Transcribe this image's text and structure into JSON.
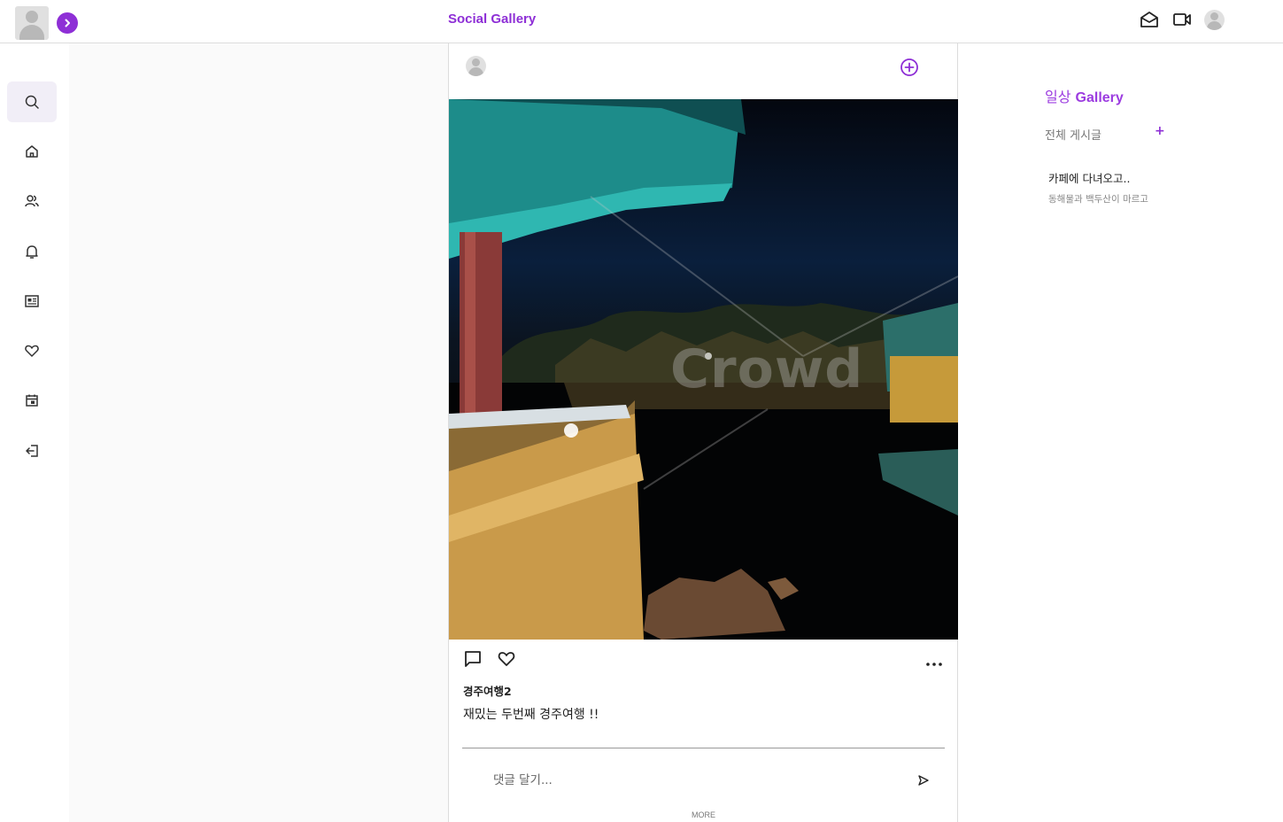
{
  "header": {
    "app_title": "Social Gallery",
    "brand_color": "#8e2fd6",
    "icons": [
      "profile-avatar-icon",
      "expand-sidebar-icon",
      "mail-icon",
      "video-icon",
      "user-avatar-icon"
    ]
  },
  "sidebar": {
    "items": [
      {
        "name": "search",
        "icon": "search-icon",
        "active": true
      },
      {
        "name": "home",
        "icon": "home-icon"
      },
      {
        "name": "friends",
        "icon": "users-icon"
      },
      {
        "name": "notifications",
        "icon": "bell-icon"
      },
      {
        "name": "feed",
        "icon": "newspaper-icon"
      },
      {
        "name": "likes",
        "icon": "heart-icon"
      },
      {
        "name": "calendar",
        "icon": "calendar-icon"
      },
      {
        "name": "logout",
        "icon": "logout-icon"
      }
    ]
  },
  "post": {
    "image_watermark": "Crowd",
    "title": "경주여행2",
    "body": "재밌는 두번째 경주여행 !!",
    "comment_placeholder": "댓글 달기...",
    "more_label": "MORE"
  },
  "gallery_panel": {
    "title_ko": "일상",
    "title_en": "Gallery",
    "all_posts_label": "전체 게시글",
    "add_label": "+",
    "items": [
      {
        "title": "카페에 다녀오고..",
        "subtitle": "동해물과 백두산이 마르고"
      }
    ]
  }
}
